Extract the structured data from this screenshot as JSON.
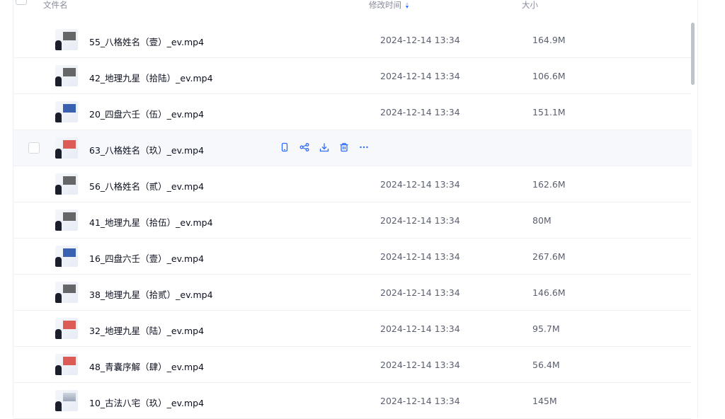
{
  "header": {
    "name_label": "文件名",
    "time_label": "修改时间",
    "size_label": "大小"
  },
  "rows": [
    {
      "name": "55_八格姓名（壹）_ev.mp4",
      "time": "2024-12-14 13:34",
      "size": "164.9M"
    },
    {
      "name": "42_地理九星（拾陆）_ev.mp4",
      "time": "2024-12-14 13:34",
      "size": "106.6M"
    },
    {
      "name": "20_四盘六壬（伍）_ev.mp4",
      "time": "2024-12-14 13:34",
      "size": "151.1M"
    },
    {
      "name": "63_八格姓名（玖）_ev.mp4",
      "time": "",
      "size": ""
    },
    {
      "name": "56_八格姓名（贰）_ev.mp4",
      "time": "2024-12-14 13:34",
      "size": "162.6M"
    },
    {
      "name": "41_地理九星（拾伍）_ev.mp4",
      "time": "2024-12-14 13:34",
      "size": "80M"
    },
    {
      "name": "16_四盘六壬（壹）_ev.mp4",
      "time": "2024-12-14 13:34",
      "size": "267.6M"
    },
    {
      "name": "38_地理九星（拾贰）_ev.mp4",
      "time": "2024-12-14 13:34",
      "size": "146.6M"
    },
    {
      "name": "32_地理九星（陆）_ev.mp4",
      "time": "2024-12-14 13:34",
      "size": "95.7M"
    },
    {
      "name": "48_青囊序解（肆）_ev.mp4",
      "time": "2024-12-14 13:34",
      "size": "56.4M"
    },
    {
      "name": "10_古法八宅（玖）_ev.mp4",
      "time": "2024-12-14 13:34",
      "size": "145M"
    }
  ],
  "hover_actions": [
    "phone-icon",
    "share-icon",
    "download-icon",
    "trash-icon",
    "more-icon"
  ],
  "colors": {
    "accent": "#2f6bff",
    "hover_bg": "#f6f8fc"
  }
}
